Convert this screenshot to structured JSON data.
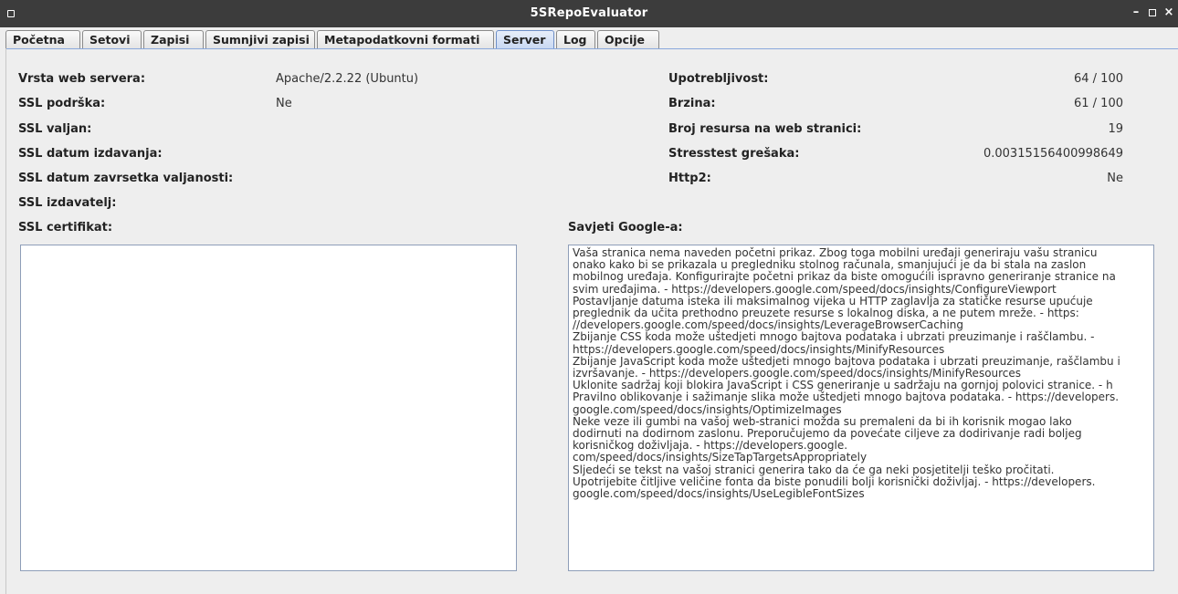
{
  "window": {
    "title": "5SRepoEvaluator",
    "minimize": "–",
    "close": "×"
  },
  "tabs": [
    {
      "label": "Početna",
      "active": false
    },
    {
      "label": "Setovi",
      "active": false
    },
    {
      "label": "Zapisi",
      "active": false
    },
    {
      "label": "Sumnjivi zapisi",
      "active": false
    },
    {
      "label": "Metapodatkovni formati",
      "active": false
    },
    {
      "label": "Server",
      "active": true
    },
    {
      "label": "Log",
      "active": false
    },
    {
      "label": "Opcije",
      "active": false
    }
  ],
  "server": {
    "web_server_label": "Vrsta web servera:",
    "web_server_value": "Apache/2.2.22 (Ubuntu)",
    "ssl_support_label": "SSL podrška:",
    "ssl_support_value": "Ne",
    "ssl_valid_label": "SSL valjan:",
    "ssl_issue_date_label": "SSL datum izdavanja:",
    "ssl_expiry_label": "SSL datum zavrsetka valjanosti:",
    "ssl_issuer_label": "SSL izdavatelj:",
    "ssl_cert_label": "SSL certifikat:",
    "ssl_cert_text": ""
  },
  "metrics": {
    "usability_label": "Upotrebljivost:",
    "usability_value": "64 / 100",
    "speed_label": "Brzina:",
    "speed_value": "61 / 100",
    "resources_label": "Broj resursa na web stranici:",
    "resources_value": "19",
    "stress_label": "Stresstest grešaka:",
    "stress_value": "0.00315156400998649",
    "http2_label": "Http2:",
    "http2_value": "Ne"
  },
  "google": {
    "label": "Savjeti Google-a:",
    "lines": [
      "Vaša stranica nema naveden početni prikaz. Zbog toga mobilni uređaji generiraju vašu stranicu",
      "onako kako bi se prikazala u pregledniku stolnog računala, smanjujući je da bi stala na zaslon",
      "mobilnog uređaja. Konfigurirajte početni prikaz da biste omogućili ispravno generiranje stranice na",
      "svim uređajima. - https://developers.google.com/speed/docs/insights/ConfigureViewport",
      "Postavljanje datuma isteka ili maksimalnog vijeka u HTTP zaglavlja za statičke resurse upućuje",
      "preglednik da učita prethodno preuzete resurse s lokalnog diska, a ne putem mreže. - https:",
      "//developers.google.com/speed/docs/insights/LeverageBrowserCaching",
      "Zbijanje CSS koda može uštedjeti mnogo bajtova podataka i ubrzati preuzimanje i raščlambu. -",
      "https://developers.google.com/speed/docs/insights/MinifyResources",
      "Zbijanje JavaScript koda može uštedjeti mnogo bajtova podataka i ubrzati preuzimanje, raščlambu i",
      "izvršavanje. - https://developers.google.com/speed/docs/insights/MinifyResources",
      "Uklonite sadržaj koji blokira JavaScript i CSS generiranje u sadržaju na gornjoj polovici stranice. - h",
      "Pravilno oblikovanje i sažimanje slika može uštedjeti mnogo bajtova podataka. - https://developers.",
      "google.com/speed/docs/insights/OptimizeImages",
      "Neke veze ili gumbi na vašoj web-stranici možda su premaleni da bi ih korisnik mogao lako",
      "dodirnuti na dodirnom zaslonu. Preporučujemo da povećate ciljeve za dodirivanje radi boljeg",
      "korisničkog doživljaja. - https://developers.google.",
      "com/speed/docs/insights/SizeTapTargetsAppropriately",
      "Sljedeći se tekst na vašoj stranici generira tako da će ga neki posjetitelji teško pročitati.",
      "Upotrijebite čitljive veličine fonta da biste ponudili bolji korisnički doživljaj. - https://developers.",
      "google.com/speed/docs/insights/UseLegibleFontSizes"
    ]
  }
}
